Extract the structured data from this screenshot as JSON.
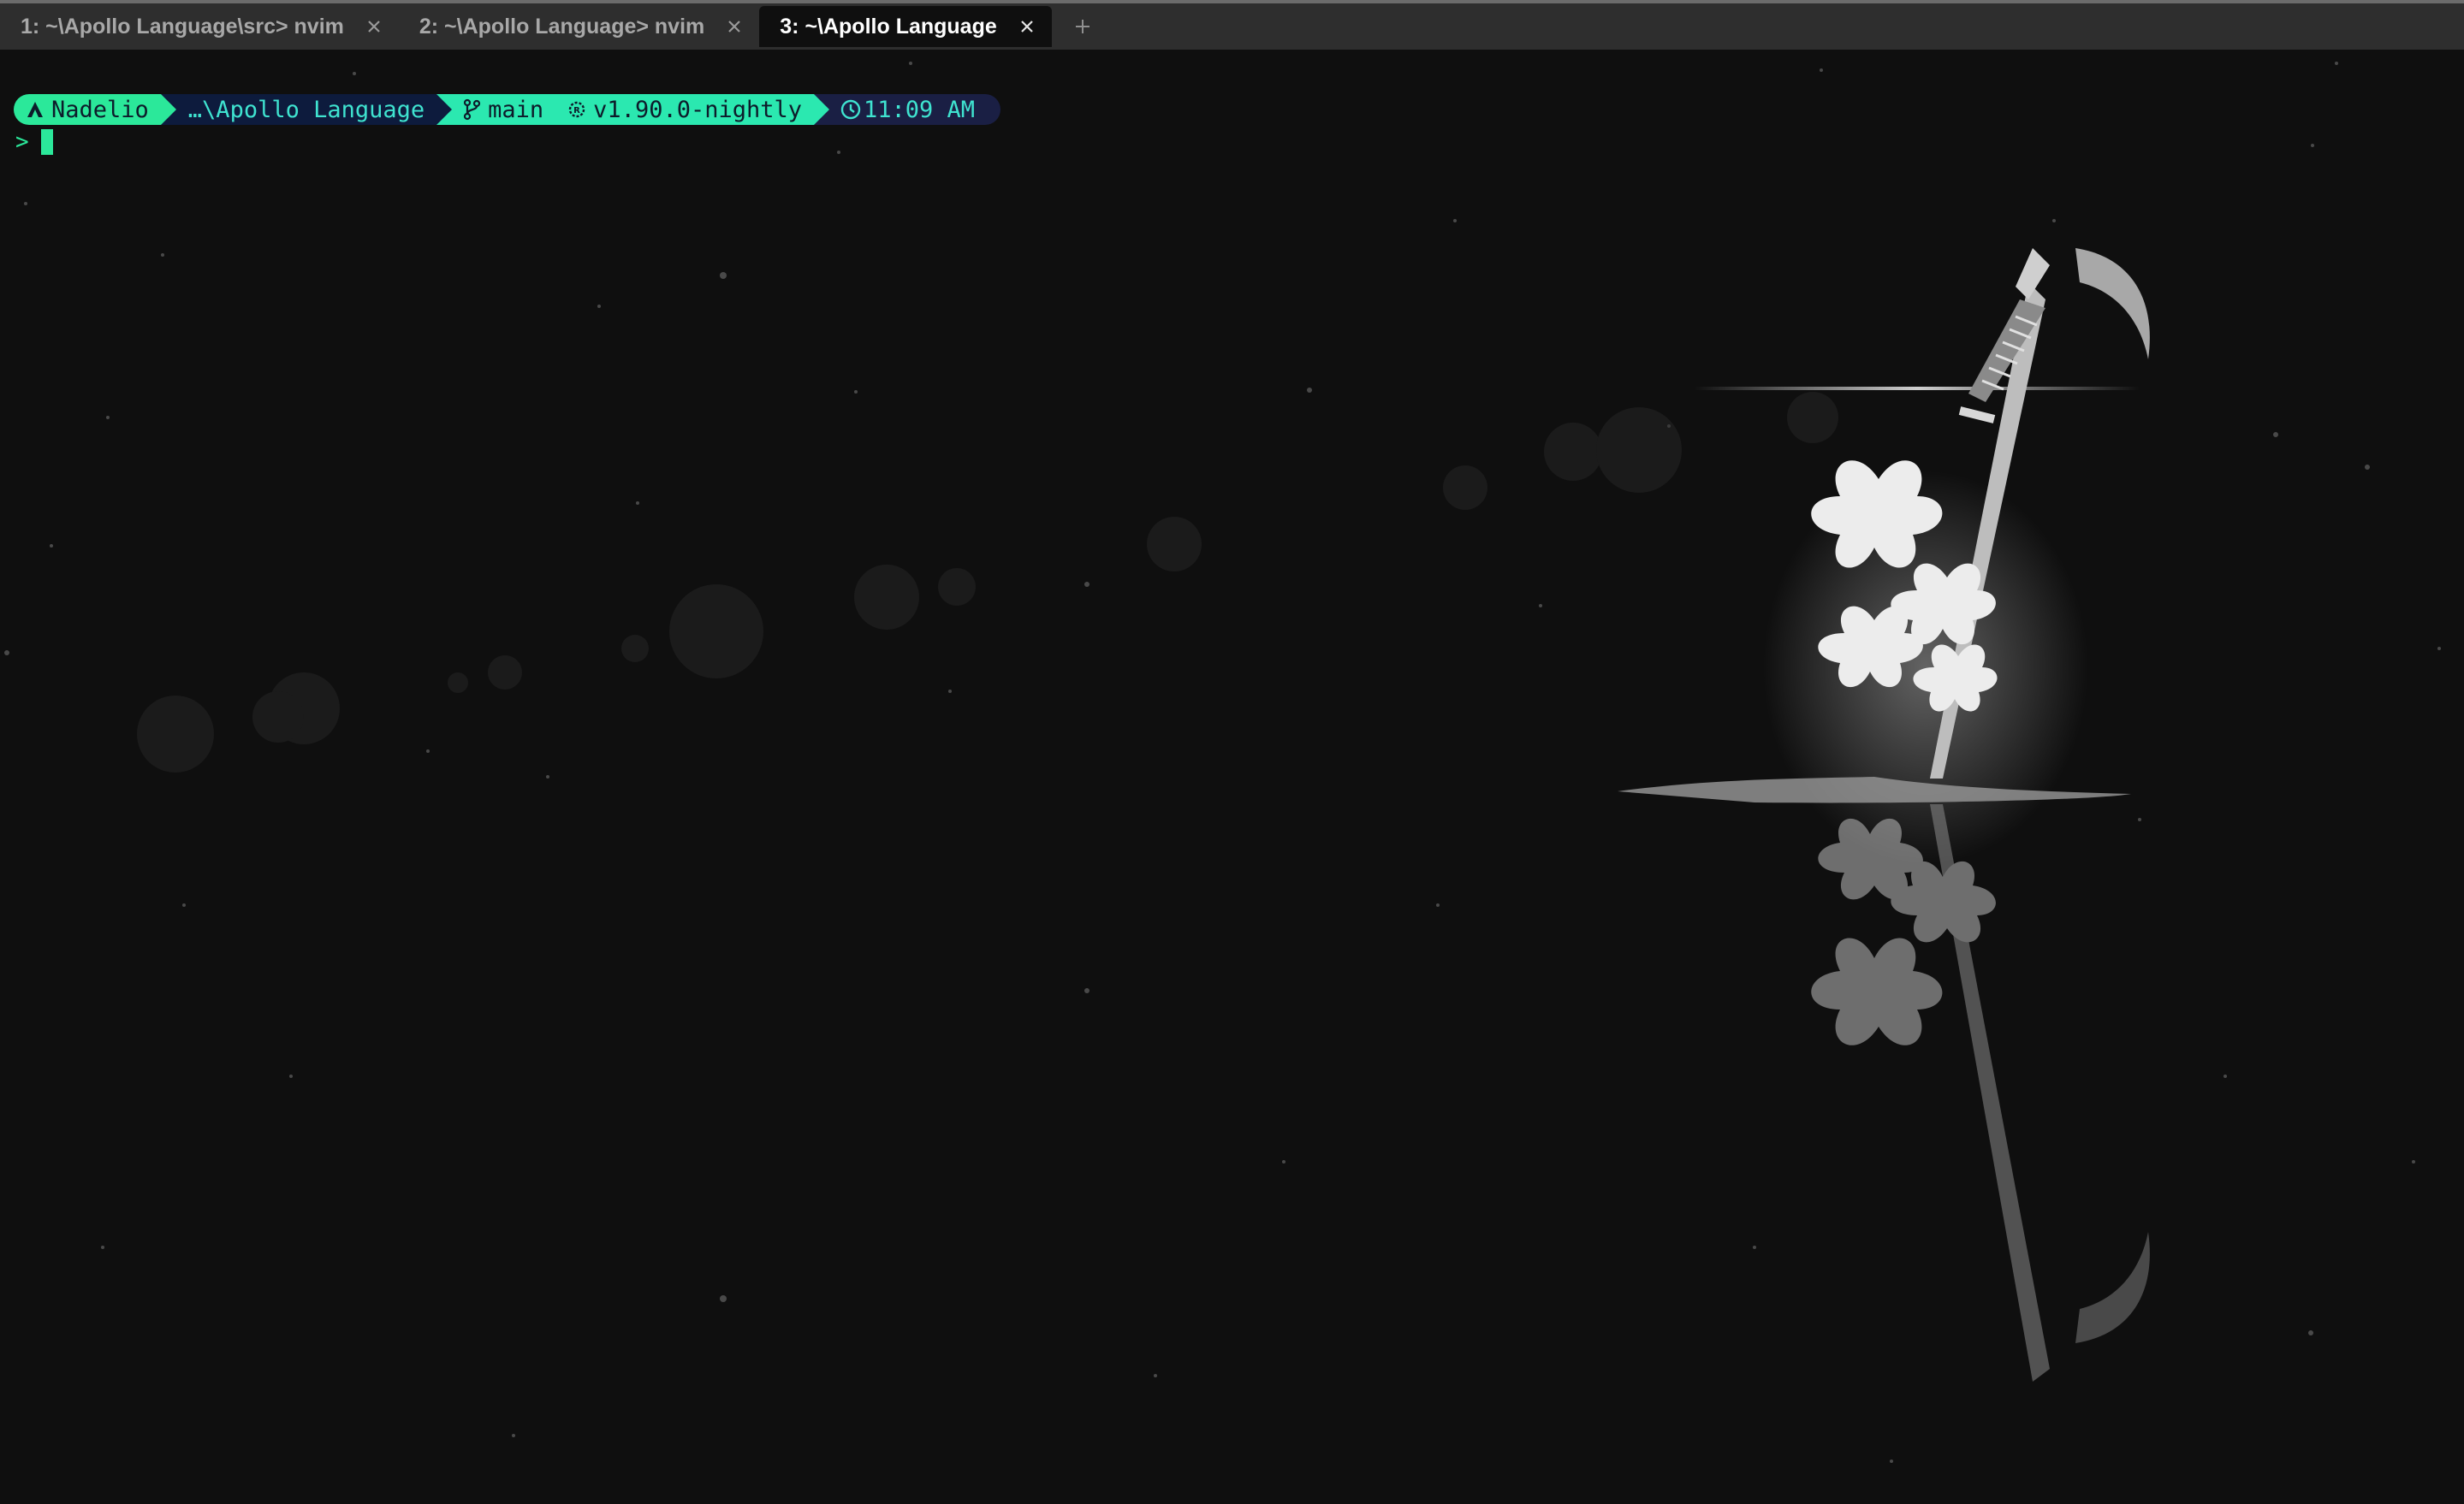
{
  "tabs": [
    {
      "label": "1: ~\\Apollo Language\\src> nvim",
      "active": false
    },
    {
      "label": "2: ~\\Apollo Language> nvim",
      "active": false
    },
    {
      "label": "3: ~\\Apollo Language",
      "active": true
    }
  ],
  "new_tab_icon": "plus-icon",
  "prompt": {
    "user": "Nadelio",
    "path": "…\\Apollo Language",
    "branch": "main",
    "version": "v1.90.0-nightly",
    "time": "11:09 AM",
    "symbol": ">"
  },
  "colors": {
    "accent": "#2be89a",
    "path_bg": "#0d1b3d",
    "time_bg": "#1a1f44",
    "path_text": "#3fe3d0",
    "background": "#0f0f0f"
  }
}
